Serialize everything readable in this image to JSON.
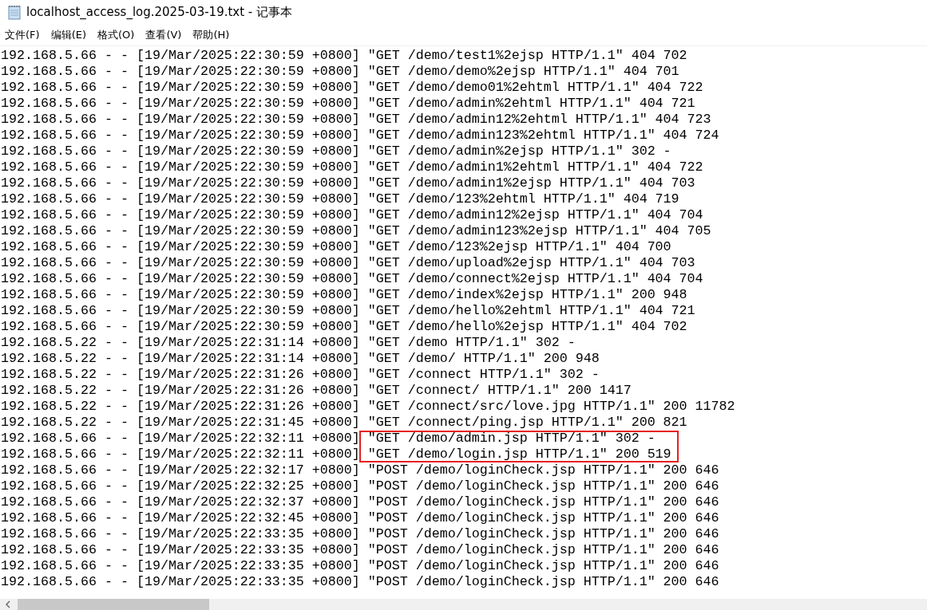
{
  "window": {
    "title": "localhost_access_log.2025-03-19.txt - 记事本"
  },
  "menu": [
    {
      "label": "文件(F)"
    },
    {
      "label": "编辑(E)"
    },
    {
      "label": "格式(O)"
    },
    {
      "label": "查看(V)"
    },
    {
      "label": "帮助(H)"
    }
  ],
  "lines": [
    {
      "text": "192.168.5.66 - - [19/Mar/2025:22:30:59 +0800] \"GET /demo/test1%2ejsp HTTP/1.1\" 404 702",
      "highlighted": false
    },
    {
      "text": "192.168.5.66 - - [19/Mar/2025:22:30:59 +0800] \"GET /demo/demo%2ejsp HTTP/1.1\" 404 701",
      "highlighted": false
    },
    {
      "text": "192.168.5.66 - - [19/Mar/2025:22:30:59 +0800] \"GET /demo/demo01%2ehtml HTTP/1.1\" 404 722",
      "highlighted": false
    },
    {
      "text": "192.168.5.66 - - [19/Mar/2025:22:30:59 +0800] \"GET /demo/admin%2ehtml HTTP/1.1\" 404 721",
      "highlighted": false
    },
    {
      "text": "192.168.5.66 - - [19/Mar/2025:22:30:59 +0800] \"GET /demo/admin12%2ehtml HTTP/1.1\" 404 723",
      "highlighted": false
    },
    {
      "text": "192.168.5.66 - - [19/Mar/2025:22:30:59 +0800] \"GET /demo/admin123%2ehtml HTTP/1.1\" 404 724",
      "highlighted": false
    },
    {
      "text": "192.168.5.66 - - [19/Mar/2025:22:30:59 +0800] \"GET /demo/admin%2ejsp HTTP/1.1\" 302 -",
      "highlighted": false
    },
    {
      "text": "192.168.5.66 - - [19/Mar/2025:22:30:59 +0800] \"GET /demo/admin1%2ehtml HTTP/1.1\" 404 722",
      "highlighted": false
    },
    {
      "text": "192.168.5.66 - - [19/Mar/2025:22:30:59 +0800] \"GET /demo/admin1%2ejsp HTTP/1.1\" 404 703",
      "highlighted": false
    },
    {
      "text": "192.168.5.66 - - [19/Mar/2025:22:30:59 +0800] \"GET /demo/123%2ehtml HTTP/1.1\" 404 719",
      "highlighted": false
    },
    {
      "text": "192.168.5.66 - - [19/Mar/2025:22:30:59 +0800] \"GET /demo/admin12%2ejsp HTTP/1.1\" 404 704",
      "highlighted": false
    },
    {
      "text": "192.168.5.66 - - [19/Mar/2025:22:30:59 +0800] \"GET /demo/admin123%2ejsp HTTP/1.1\" 404 705",
      "highlighted": false
    },
    {
      "text": "192.168.5.66 - - [19/Mar/2025:22:30:59 +0800] \"GET /demo/123%2ejsp HTTP/1.1\" 404 700",
      "highlighted": false
    },
    {
      "text": "192.168.5.66 - - [19/Mar/2025:22:30:59 +0800] \"GET /demo/upload%2ejsp HTTP/1.1\" 404 703",
      "highlighted": false
    },
    {
      "text": "192.168.5.66 - - [19/Mar/2025:22:30:59 +0800] \"GET /demo/connect%2ejsp HTTP/1.1\" 404 704",
      "highlighted": false
    },
    {
      "text": "192.168.5.66 - - [19/Mar/2025:22:30:59 +0800] \"GET /demo/index%2ejsp HTTP/1.1\" 200 948",
      "highlighted": false
    },
    {
      "text": "192.168.5.66 - - [19/Mar/2025:22:30:59 +0800] \"GET /demo/hello%2ehtml HTTP/1.1\" 404 721",
      "highlighted": false
    },
    {
      "text": "192.168.5.66 - - [19/Mar/2025:22:30:59 +0800] \"GET /demo/hello%2ejsp HTTP/1.1\" 404 702",
      "highlighted": false
    },
    {
      "text": "192.168.5.22 - - [19/Mar/2025:22:31:14 +0800] \"GET /demo HTTP/1.1\" 302 -",
      "highlighted": false
    },
    {
      "text": "192.168.5.22 - - [19/Mar/2025:22:31:14 +0800] \"GET /demo/ HTTP/1.1\" 200 948",
      "highlighted": false
    },
    {
      "text": "192.168.5.22 - - [19/Mar/2025:22:31:26 +0800] \"GET /connect HTTP/1.1\" 302 -",
      "highlighted": false
    },
    {
      "text": "192.168.5.22 - - [19/Mar/2025:22:31:26 +0800] \"GET /connect/ HTTP/1.1\" 200 1417",
      "highlighted": false
    },
    {
      "text": "192.168.5.22 - - [19/Mar/2025:22:31:26 +0800] \"GET /connect/src/love.jpg HTTP/1.1\" 200 11782",
      "highlighted": false
    },
    {
      "text": "192.168.5.22 - - [19/Mar/2025:22:31:45 +0800] \"GET /connect/ping.jsp HTTP/1.1\" 200 821",
      "highlighted": false
    },
    {
      "text": "192.168.5.66 - - [19/Mar/2025:22:32:11 +0800] \"GET /demo/admin.jsp HTTP/1.1\" 302 -",
      "highlighted": true
    },
    {
      "text": "192.168.5.66 - - [19/Mar/2025:22:32:11 +0800] \"GET /demo/login.jsp HTTP/1.1\" 200 519",
      "highlighted": true
    },
    {
      "text": "192.168.5.66 - - [19/Mar/2025:22:32:17 +0800] \"POST /demo/loginCheck.jsp HTTP/1.1\" 200 646",
      "highlighted": false
    },
    {
      "text": "192.168.5.66 - - [19/Mar/2025:22:32:25 +0800] \"POST /demo/loginCheck.jsp HTTP/1.1\" 200 646",
      "highlighted": false
    },
    {
      "text": "192.168.5.66 - - [19/Mar/2025:22:32:37 +0800] \"POST /demo/loginCheck.jsp HTTP/1.1\" 200 646",
      "highlighted": false
    },
    {
      "text": "192.168.5.66 - - [19/Mar/2025:22:32:45 +0800] \"POST /demo/loginCheck.jsp HTTP/1.1\" 200 646",
      "highlighted": false
    },
    {
      "text": "192.168.5.66 - - [19/Mar/2025:22:33:35 +0800] \"POST /demo/loginCheck.jsp HTTP/1.1\" 200 646",
      "highlighted": false
    },
    {
      "text": "192.168.5.66 - - [19/Mar/2025:22:33:35 +0800] \"POST /demo/loginCheck.jsp HTTP/1.1\" 200 646",
      "highlighted": false
    },
    {
      "text": "192.168.5.66 - - [19/Mar/2025:22:33:35 +0800] \"POST /demo/loginCheck.jsp HTTP/1.1\" 200 646",
      "highlighted": false
    },
    {
      "text": "192.168.5.66 - - [19/Mar/2025:22:33:35 +0800] \"POST /demo/loginCheck.jsp HTTP/1.1\" 200 646",
      "highlighted": false
    }
  ]
}
